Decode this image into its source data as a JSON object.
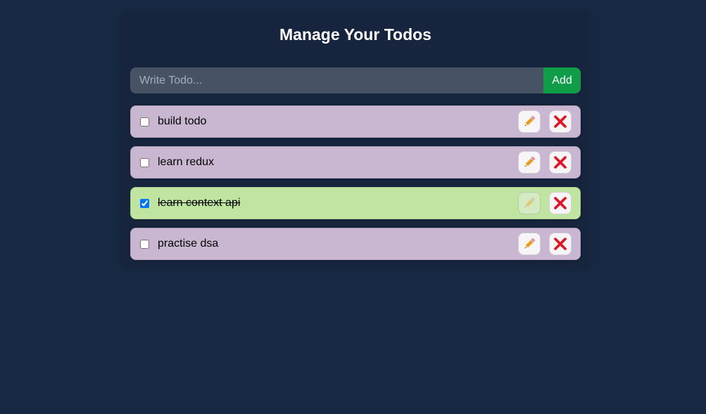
{
  "header": {
    "title": "Manage Your Todos"
  },
  "form": {
    "placeholder": "Write Todo...",
    "add_label": "Add"
  },
  "todos": [
    {
      "text": "build todo",
      "completed": false
    },
    {
      "text": "learn redux",
      "completed": false
    },
    {
      "text": "learn context api",
      "completed": true
    },
    {
      "text": "practise dsa",
      "completed": false
    }
  ],
  "icons": {
    "edit": "pencil-icon",
    "delete": "cross-icon"
  },
  "colors": {
    "background": "#172842",
    "pending_item": "#c9b7d2",
    "completed_item": "#bfe5a0",
    "add_button": "#0f9d48",
    "delete_icon": "#e8101e"
  }
}
